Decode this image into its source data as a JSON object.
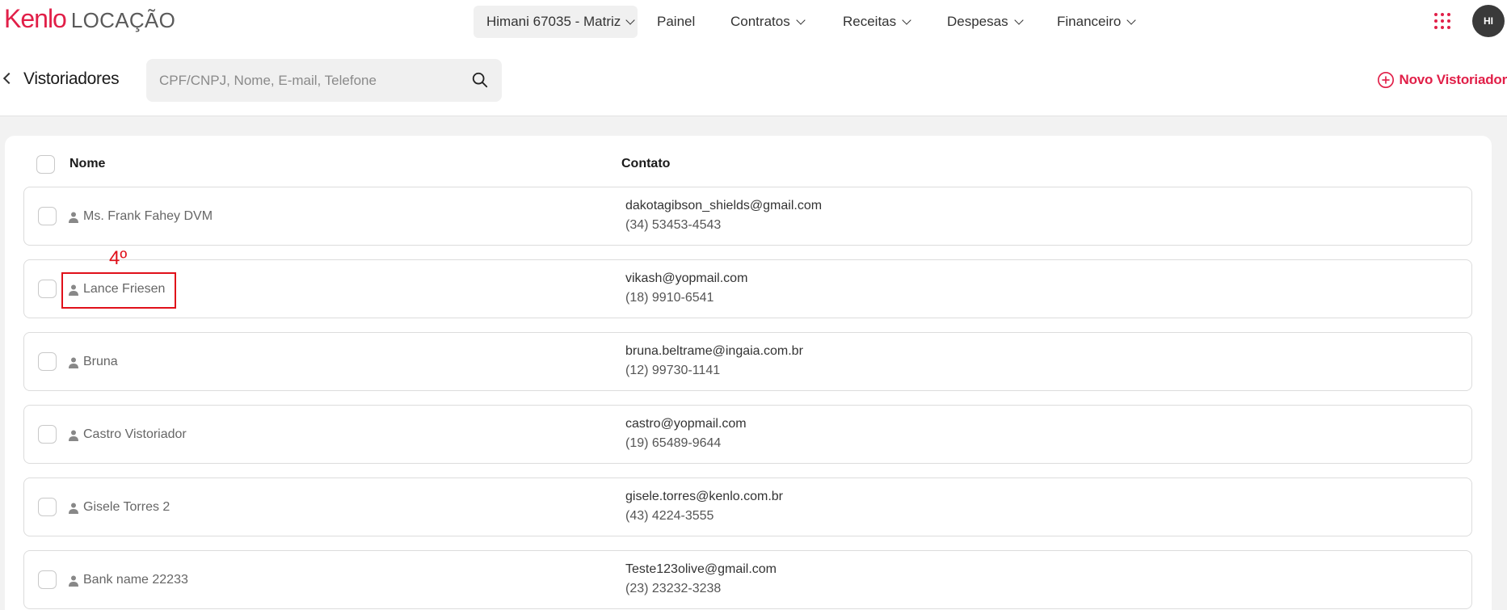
{
  "header": {
    "logo_brand": "Kenlo",
    "logo_product": "LOCAÇÃO",
    "unit_selector": "Himani 67035 - Matriz",
    "nav": [
      {
        "label": "Painel",
        "has_dropdown": false
      },
      {
        "label": "Contratos",
        "has_dropdown": true
      },
      {
        "label": "Receitas",
        "has_dropdown": true
      },
      {
        "label": "Despesas",
        "has_dropdown": true
      },
      {
        "label": "Financeiro",
        "has_dropdown": true
      }
    ],
    "apps_icon": "grid-dots-icon",
    "avatar_initials": "HI"
  },
  "subheader": {
    "title": "Vistoriadores",
    "search_placeholder": "CPF/CNPJ, Nome, E-mail, Telefone",
    "search_value": "",
    "new_button_label": "Novo Vistoriador"
  },
  "table": {
    "columns": {
      "name": "Nome",
      "contact": "Contato"
    },
    "rows": [
      {
        "name": "Ms. Frank Fahey DVM",
        "email": "dakotagibson_shields@gmail.com",
        "phone": "(34) 53453-4543"
      },
      {
        "name": "Lance Friesen",
        "email": "vikash@yopmail.com",
        "phone": "(18) 9910-6541"
      },
      {
        "name": "Bruna",
        "email": "bruna.beltrame@ingaia.com.br",
        "phone": "(12) 99730-1141"
      },
      {
        "name": "Castro Vistoriador",
        "email": "castro@yopmail.com",
        "phone": "(19) 65489-9644"
      },
      {
        "name": "Gisele Torres 2",
        "email": "gisele.torres@kenlo.com.br",
        "phone": "(43) 4224-3555"
      },
      {
        "name": "Bank name 22233",
        "email": "Teste123olive@gmail.com",
        "phone": "(23) 23232-3238"
      }
    ]
  },
  "annotation": {
    "label": "4º",
    "color": "#e0101a"
  },
  "colors": {
    "accent": "#e11f48",
    "background": "#f2f2f2"
  }
}
